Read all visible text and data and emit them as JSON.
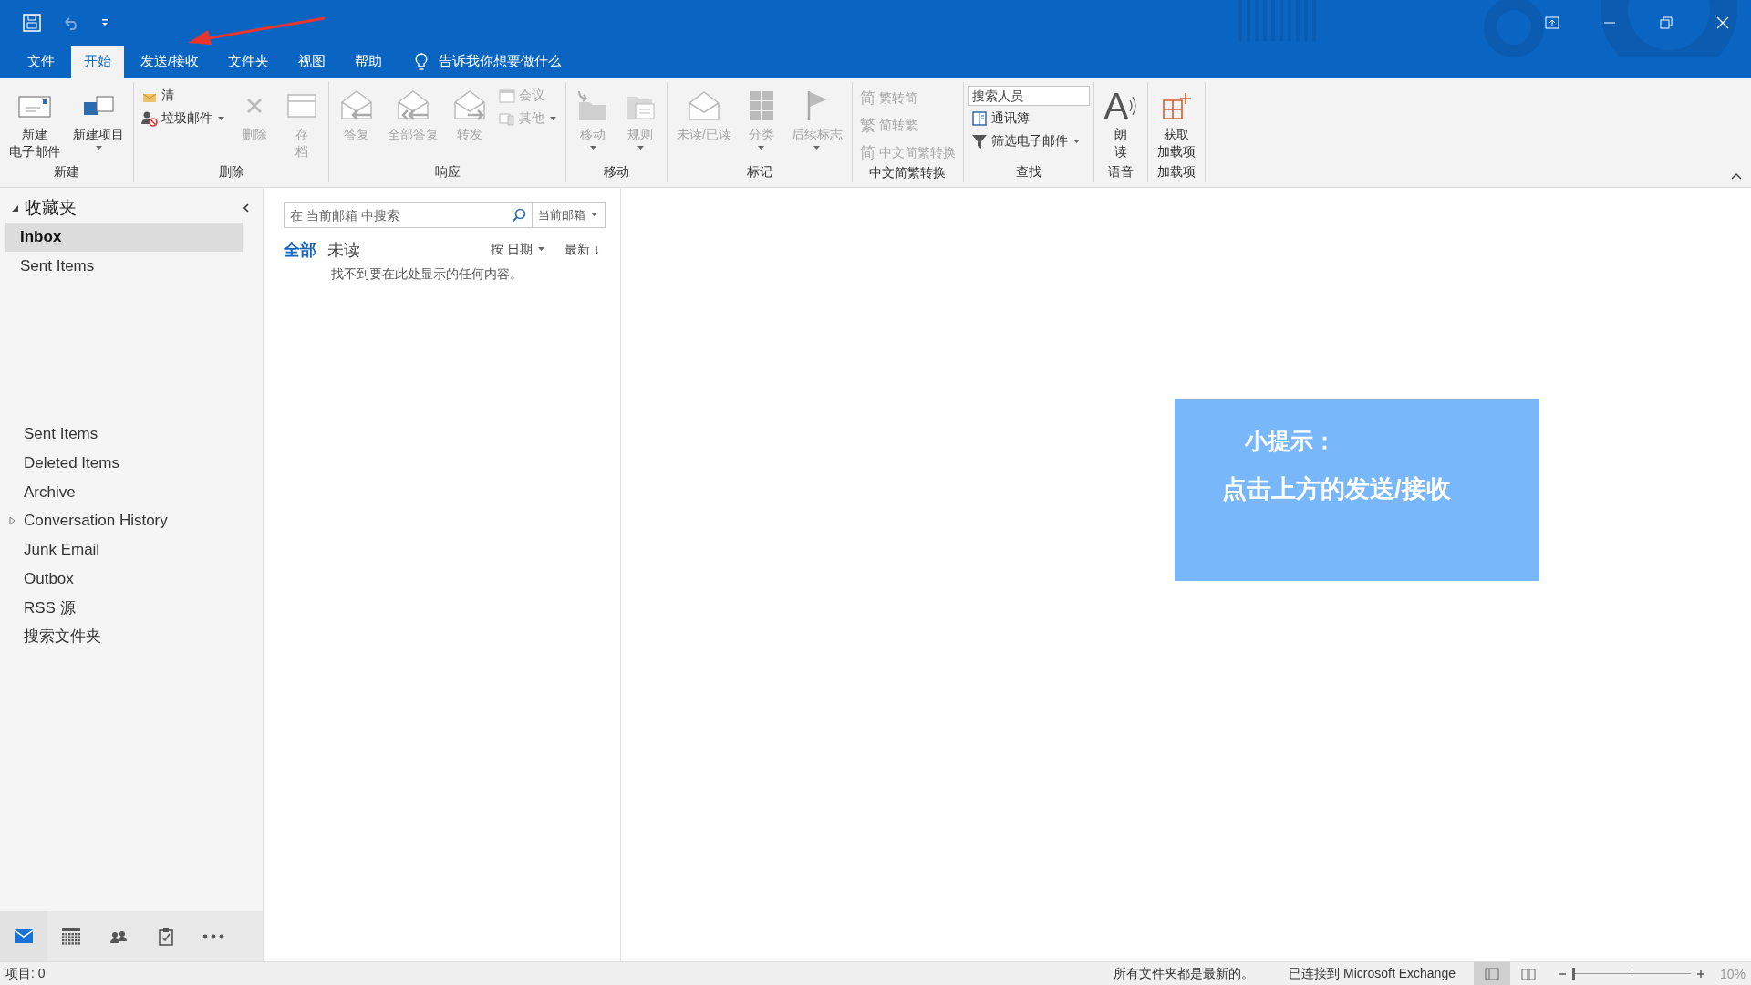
{
  "tabs": [
    {
      "label": "文件",
      "selected": false
    },
    {
      "label": "开始",
      "selected": true
    },
    {
      "label": "发送/接收",
      "selected": false
    },
    {
      "label": "文件夹",
      "selected": false
    },
    {
      "label": "视图",
      "selected": false
    },
    {
      "label": "帮助",
      "selected": false
    }
  ],
  "tell_me": "告诉我你想要做什么",
  "ribbon": {
    "groups": [
      {
        "label": "新建",
        "items": [
          {
            "kind": "large",
            "lines": [
              "新建",
              "电子邮件"
            ],
            "disabled": false,
            "dropdown": false
          },
          {
            "kind": "large",
            "lines": [
              "新建项目"
            ],
            "disabled": false,
            "dropdown": true
          }
        ]
      },
      {
        "label": "删除",
        "items": [
          {
            "kind": "stack",
            "items": [
              {
                "label": "清",
                "disabled": false,
                "dropdown": false
              },
              {
                "label": "垃圾邮件",
                "disabled": false,
                "dropdown": true
              }
            ]
          },
          {
            "kind": "large",
            "lines": [
              "删除"
            ],
            "disabled": true,
            "dropdown": false
          },
          {
            "kind": "large",
            "lines": [
              "存",
              "档"
            ],
            "disabled": true,
            "dropdown": false
          }
        ]
      },
      {
        "label": "响应",
        "items": [
          {
            "kind": "large",
            "lines": [
              "答复"
            ],
            "disabled": true,
            "dropdown": false
          },
          {
            "kind": "large",
            "lines": [
              "全部答复"
            ],
            "disabled": true,
            "dropdown": false
          },
          {
            "kind": "large",
            "lines": [
              "转发"
            ],
            "disabled": true,
            "dropdown": false
          },
          {
            "kind": "stack",
            "items": [
              {
                "label": "会议",
                "disabled": true,
                "dropdown": false
              },
              {
                "label": "其他",
                "disabled": true,
                "dropdown": true
              }
            ]
          }
        ]
      },
      {
        "label": "移动",
        "items": [
          {
            "kind": "large",
            "lines": [
              "移动"
            ],
            "disabled": true,
            "dropdown": true
          },
          {
            "kind": "large",
            "lines": [
              "规则"
            ],
            "disabled": true,
            "dropdown": true
          }
        ]
      },
      {
        "label": "标记",
        "items": [
          {
            "kind": "large",
            "lines": [
              "未读/已读"
            ],
            "disabled": true,
            "dropdown": false
          },
          {
            "kind": "large",
            "lines": [
              "分类"
            ],
            "disabled": true,
            "dropdown": true
          },
          {
            "kind": "large",
            "lines": [
              "后续标志"
            ],
            "disabled": true,
            "dropdown": true
          }
        ]
      },
      {
        "label": "中文简繁转换",
        "items": [
          {
            "kind": "stack",
            "items": [
              {
                "glyph": "简",
                "label": "繁转简",
                "disabled": true,
                "dropdown": false
              },
              {
                "glyph": "繁",
                "label": "简转繁",
                "disabled": true,
                "dropdown": false
              },
              {
                "glyph": "简",
                "label": "中文简繁转换",
                "disabled": true,
                "dropdown": false
              }
            ]
          }
        ]
      },
      {
        "label": "查找",
        "items": [
          {
            "kind": "stack",
            "items": [
              {
                "kind": "field",
                "placeholder": "搜索人员"
              },
              {
                "label": "通讯簿",
                "disabled": false,
                "dropdown": false
              },
              {
                "label": "筛选电子邮件",
                "disabled": false,
                "dropdown": true
              }
            ]
          }
        ]
      },
      {
        "label": "语音",
        "items": [
          {
            "kind": "large",
            "glyph": "A",
            "lines": [
              "朗",
              "读"
            ],
            "disabled": false,
            "dropdown": false
          }
        ]
      },
      {
        "label": "加载项",
        "items": [
          {
            "kind": "large",
            "lines": [
              "获取",
              "加载项"
            ],
            "disabled": false,
            "dropdown": false
          }
        ]
      }
    ]
  },
  "sidebar": {
    "favorites": {
      "label": "收藏夹",
      "expanded": true,
      "items": [
        {
          "label": "Inbox",
          "selected": true
        },
        {
          "label": "Sent Items",
          "selected": false
        }
      ]
    },
    "folders": [
      {
        "label": "Sent Items",
        "kind": "plain",
        "selected": false
      },
      {
        "label": "Deleted Items",
        "kind": "plain",
        "selected": false
      },
      {
        "label": "Archive",
        "kind": "plain",
        "selected": false
      },
      {
        "label": "Conversation History",
        "kind": "expandable",
        "selected": false
      },
      {
        "label": "Junk Email",
        "kind": "plain",
        "selected": false
      },
      {
        "label": "Outbox",
        "kind": "plain",
        "selected": false
      },
      {
        "label": "RSS 源",
        "kind": "plain",
        "selected": false
      },
      {
        "label": "搜索文件夹",
        "kind": "plain",
        "selected": false
      }
    ],
    "nav": [
      {
        "kind": "mail",
        "selected": true
      },
      {
        "kind": "calendar",
        "selected": false
      },
      {
        "kind": "people",
        "selected": false
      },
      {
        "kind": "tasks",
        "selected": false
      },
      {
        "kind": "more",
        "selected": false
      }
    ]
  },
  "message_list": {
    "search": {
      "placeholder": "在 当前邮箱 中搜索",
      "scope": "当前邮箱"
    },
    "filters": [
      {
        "label": "全部",
        "selected": true
      },
      {
        "label": "未读",
        "selected": false
      }
    ],
    "sort": {
      "by": "按 日期",
      "order": "最新",
      "arrow": "↓"
    },
    "empty_text": "找不到要在此处显示的任何内容。"
  },
  "tip": {
    "title": "小提示：",
    "text": "点击上方的发送/接收"
  },
  "status_bar": {
    "items": "项目: 0",
    "sync": "所有文件夹都是最新的。",
    "connection": "已连接到 Microsoft Exchange",
    "views": [
      {
        "kind": "normal",
        "selected": true
      },
      {
        "kind": "reading",
        "selected": false
      }
    ],
    "zoom": {
      "level": 0,
      "reading": "10%"
    }
  }
}
